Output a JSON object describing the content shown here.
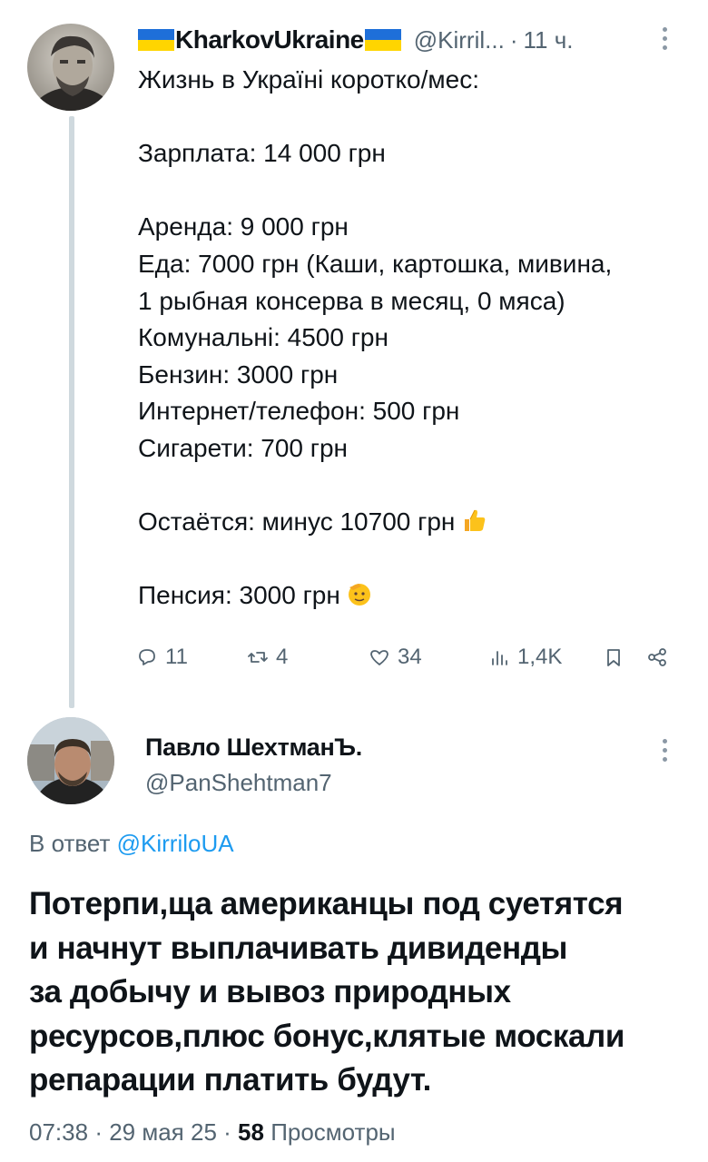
{
  "tweet1": {
    "author_name": "KharkovUkraine",
    "author_handle": "@Kirril...",
    "time": "11 ч.",
    "lines": [
      "Жизнь в Україні коротко/мес:",
      "",
      "Зарплата: 14 000 грн",
      "",
      "Аренда: 9 000 грн",
      "Еда: 7000 грн (Каши, картошка, мивина,",
      "1 рыбная консерва в месяц, 0 мяса)",
      "Комунальні: 4500 грн",
      "Бензин: 3000 грн",
      "Интернет/телефон: 500 грн",
      "Сигарети: 700 грн",
      "",
      "Остаётся: минус 10700 грн",
      "",
      "Пенсия: 3000 грн"
    ],
    "emoji_thumbs": "thumbs-up-emoji",
    "emoji_salute": "saluting-face-emoji",
    "actions": {
      "replies": "11",
      "retweets": "4",
      "likes": "34",
      "views": "1,4K"
    }
  },
  "tweet2": {
    "author_name": "Павло ШехтманЪ.",
    "author_handle": "@PanShehtman7",
    "reply_prefix": "В ответ",
    "reply_handle": "@KirriloUA",
    "text_lines": [
      "Потерпи,ща американцы под суетятся",
      "и начнут выплачивать дивиденды",
      "за добычу и вывоз природных",
      "ресурсов,плюс бонус,клятые москали",
      "репарации платить будут."
    ],
    "time": "07:38",
    "date": "29 мая 25",
    "views_count": "58",
    "views_label": "Просмотры"
  },
  "colors": {
    "text": "#0f1419",
    "secondary": "#536471",
    "link": "#1d9bf0",
    "flag_blue": "#1e6fd9",
    "flag_yellow": "#ffd500"
  },
  "icons": [
    "reply-icon",
    "retweet-icon",
    "like-icon",
    "views-icon",
    "bookmark-icon",
    "share-icon",
    "more-icon"
  ]
}
